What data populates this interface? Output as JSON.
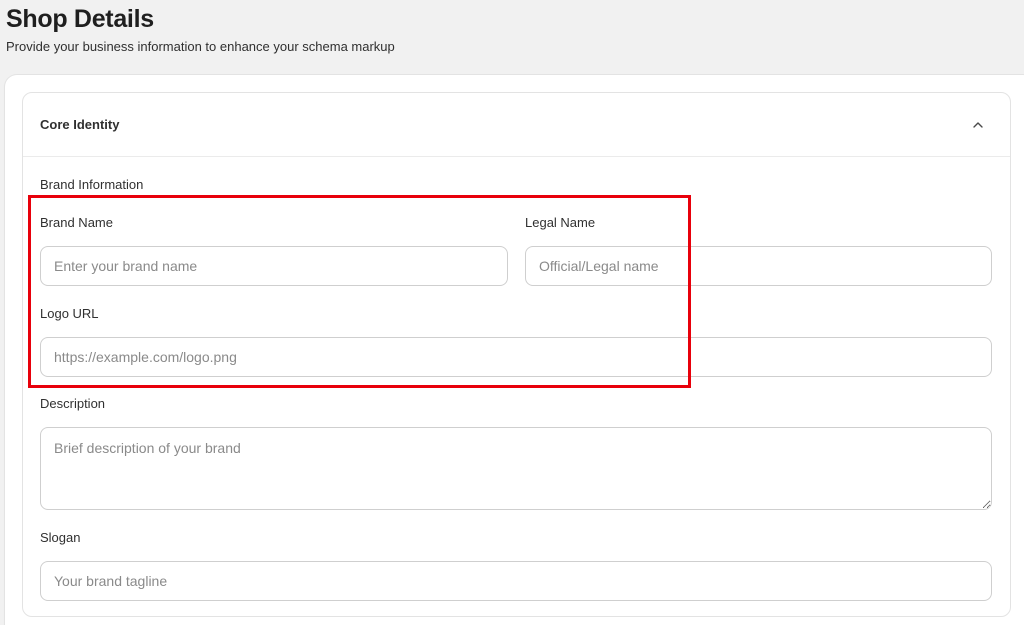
{
  "header": {
    "title": "Shop Details",
    "subtitle": "Provide your business information to enhance your schema markup"
  },
  "section": {
    "title": "Core Identity",
    "toggle_icon": "chevron-up-icon",
    "group_label": "Brand Information"
  },
  "fields": {
    "brand_name": {
      "label": "Brand Name",
      "value": "",
      "placeholder": "Enter your brand name"
    },
    "legal_name": {
      "label": "Legal Name",
      "value": "",
      "placeholder": "Official/Legal name"
    },
    "logo_url": {
      "label": "Logo URL",
      "value": "",
      "placeholder": "https://example.com/logo.png"
    },
    "description": {
      "label": "Description",
      "value": "",
      "placeholder": "Brief description of your brand"
    },
    "slogan": {
      "label": "Slogan",
      "value": "",
      "placeholder": "Your brand tagline"
    }
  },
  "annotation": {
    "highlight_color": "#e8000b"
  }
}
